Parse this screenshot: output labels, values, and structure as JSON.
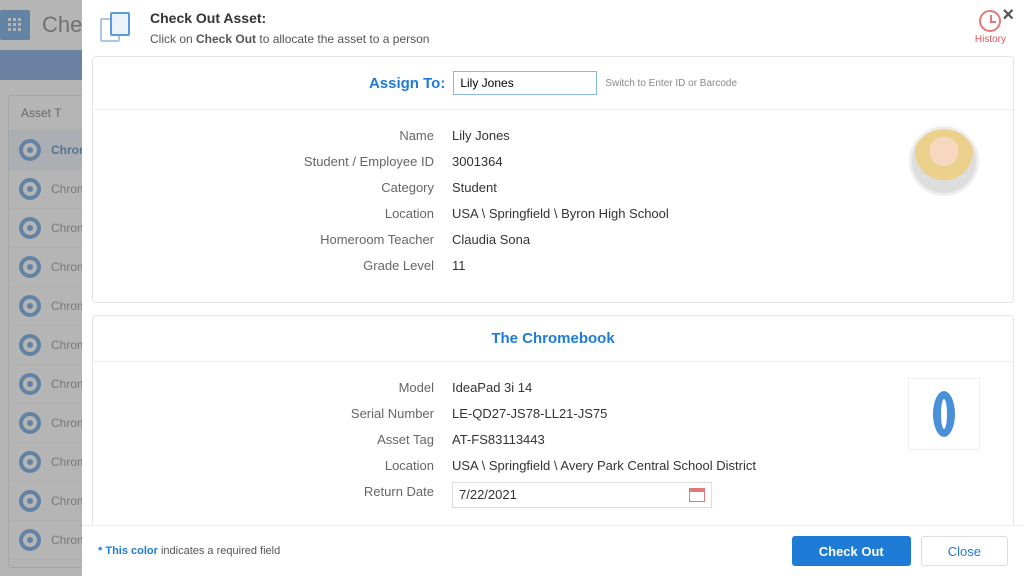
{
  "background": {
    "page_title": "Chec",
    "column_header": "Asset T",
    "rows": [
      "Chrome",
      "Chrome",
      "Chrome",
      "Chrome",
      "Chrome",
      "Chrome",
      "Chrome",
      "Chrome",
      "Chrome",
      "Chrome",
      "Chrome"
    ]
  },
  "modal": {
    "title": "Check Out Asset:",
    "subtitle_pre": "Click on ",
    "subtitle_bold": "Check Out",
    "subtitle_post": " to allocate the asset to a person",
    "history_label": "History",
    "close_glyph": "×"
  },
  "assign": {
    "label": "Assign To:",
    "value": "Lily Jones",
    "switch_text": "Switch to Enter ID or Barcode"
  },
  "person": {
    "fields": {
      "name": {
        "label": "Name",
        "value": "Lily Jones"
      },
      "id": {
        "label": "Student / Employee ID",
        "value": "3001364"
      },
      "category": {
        "label": "Category",
        "value": "Student"
      },
      "location": {
        "label": "Location",
        "value": "USA \\ Springfield \\ Byron High School"
      },
      "homeroom": {
        "label": "Homeroom Teacher",
        "value": "Claudia Sona"
      },
      "grade": {
        "label": "Grade Level",
        "value": "11"
      }
    }
  },
  "asset": {
    "section_title": "The Chromebook",
    "fields": {
      "model": {
        "label": "Model",
        "value": "IdeaPad 3i 14"
      },
      "serial": {
        "label": "Serial Number",
        "value": "LE-QD27-JS78-LL21-JS75"
      },
      "tag": {
        "label": "Asset Tag",
        "value": "AT-FS83113443"
      },
      "location": {
        "label": "Location",
        "value": "USA \\ Springfield \\ Avery Park Central School District"
      },
      "return": {
        "label": "Return Date",
        "value": "7/22/2021"
      }
    }
  },
  "footer": {
    "req_star": "* ",
    "req_blue": "This color",
    "req_rest": " indicates a required field",
    "checkout": "Check Out",
    "close": "Close"
  }
}
